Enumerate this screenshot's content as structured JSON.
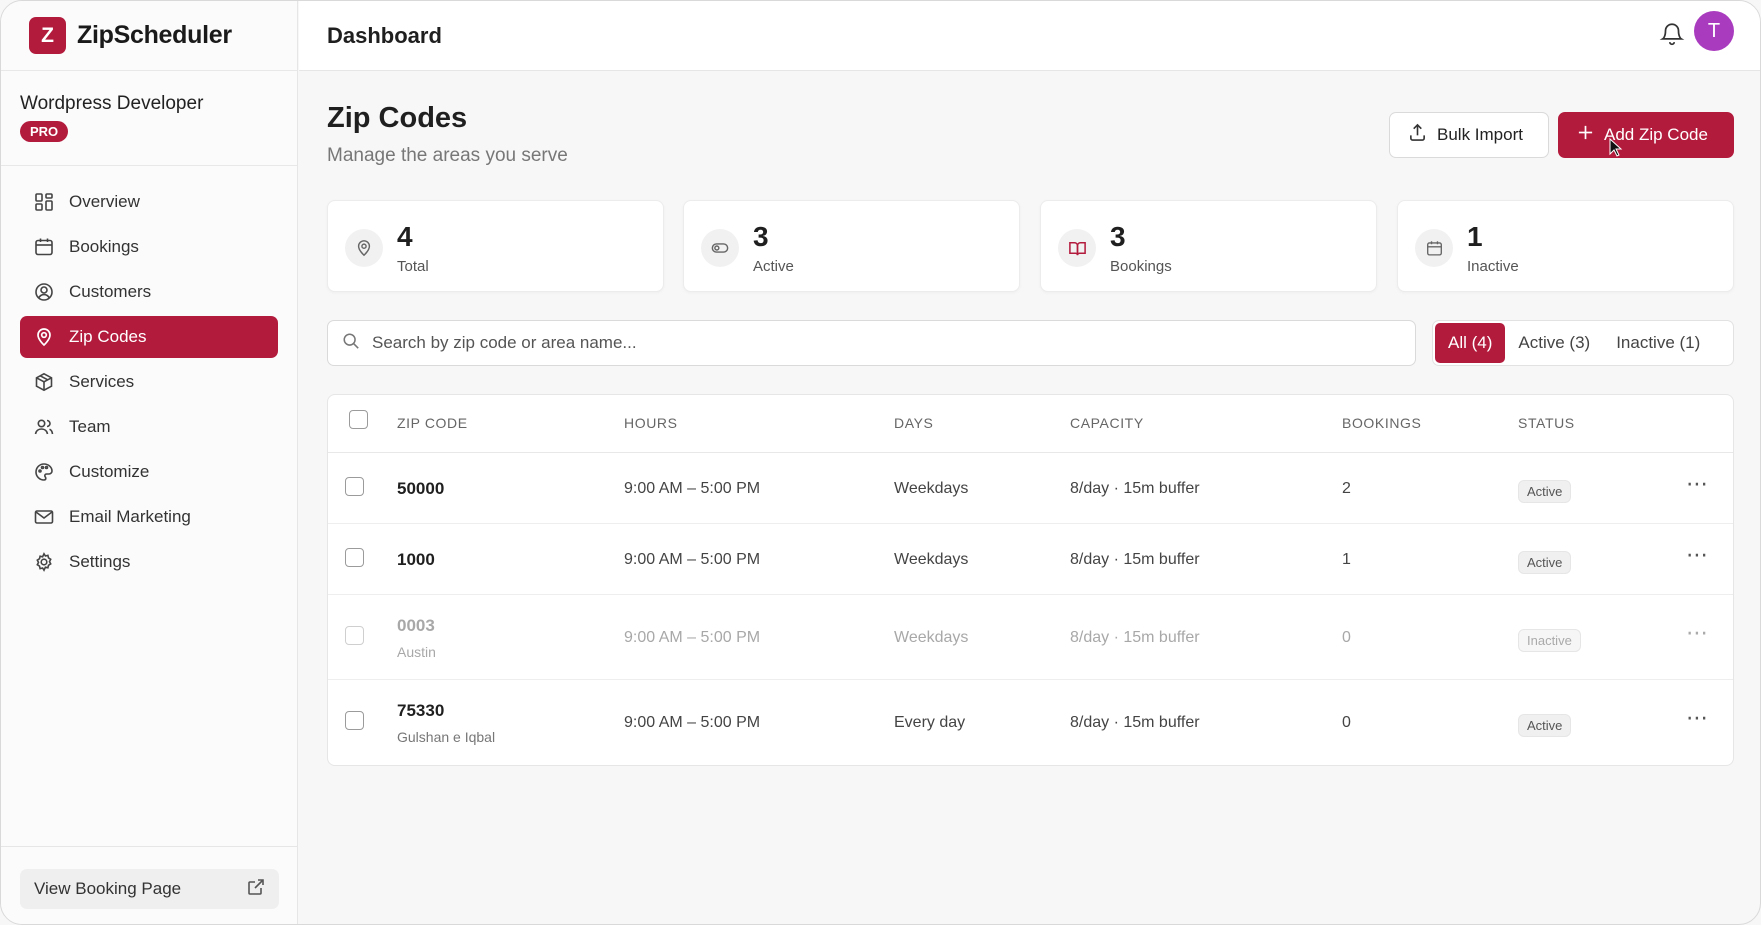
{
  "brand": {
    "logo_letter": "Z",
    "name": "ZipScheduler"
  },
  "workspace": {
    "name": "Wordpress Developer",
    "plan": "PRO"
  },
  "nav": {
    "items": [
      {
        "label": "Overview",
        "icon": "grid-icon",
        "active": false
      },
      {
        "label": "Bookings",
        "icon": "calendar-icon",
        "active": false
      },
      {
        "label": "Customers",
        "icon": "user-circle-icon",
        "active": false
      },
      {
        "label": "Zip Codes",
        "icon": "map-pin-icon",
        "active": true
      },
      {
        "label": "Services",
        "icon": "package-icon",
        "active": false
      },
      {
        "label": "Team",
        "icon": "users-icon",
        "active": false
      },
      {
        "label": "Customize",
        "icon": "palette-icon",
        "active": false
      },
      {
        "label": "Email Marketing",
        "icon": "mail-icon",
        "active": false
      },
      {
        "label": "Settings",
        "icon": "gear-icon",
        "active": false
      }
    ]
  },
  "footer": {
    "view_booking": "View Booking Page"
  },
  "topbar": {
    "title": "Dashboard",
    "avatar_letter": "T"
  },
  "page": {
    "title": "Zip Codes",
    "subtitle": "Manage the areas you serve",
    "bulk_import": "Bulk Import",
    "add_zip": "Add Zip Code"
  },
  "stats": [
    {
      "value": "4",
      "label": "Total",
      "icon": "map-pin-icon"
    },
    {
      "value": "3",
      "label": "Active",
      "icon": "toggle-icon"
    },
    {
      "value": "3",
      "label": "Bookings",
      "icon": "book-open-icon"
    },
    {
      "value": "1",
      "label": "Inactive",
      "icon": "calendar-icon"
    }
  ],
  "search": {
    "placeholder": "Search by zip code or area name..."
  },
  "filters": [
    {
      "label": "All (4)",
      "active": true
    },
    {
      "label": "Active (3)",
      "active": false
    },
    {
      "label": "Inactive (1)",
      "active": false
    }
  ],
  "table": {
    "columns": [
      "ZIP CODE",
      "HOURS",
      "DAYS",
      "CAPACITY",
      "BOOKINGS",
      "STATUS"
    ],
    "rows": [
      {
        "zip": "50000",
        "area": "",
        "hours": "9:00 AM – 5:00 PM",
        "days": "Weekdays",
        "capacity": "8/day · 15m buffer",
        "bookings": "2",
        "status": "Active"
      },
      {
        "zip": "1000",
        "area": "",
        "hours": "9:00 AM – 5:00 PM",
        "days": "Weekdays",
        "capacity": "8/day · 15m buffer",
        "bookings": "1",
        "status": "Active"
      },
      {
        "zip": "0003",
        "area": "Austin",
        "hours": "9:00 AM – 5:00 PM",
        "days": "Weekdays",
        "capacity": "8/day · 15m buffer",
        "bookings": "0",
        "status": "Inactive"
      },
      {
        "zip": "75330",
        "area": "Gulshan e Iqbal",
        "hours": "9:00 AM – 5:00 PM",
        "days": "Every day",
        "capacity": "8/day · 15m buffer",
        "bookings": "0",
        "status": "Active"
      }
    ]
  },
  "colors": {
    "accent": "#b31b3d",
    "avatar": "#a93bbf"
  }
}
